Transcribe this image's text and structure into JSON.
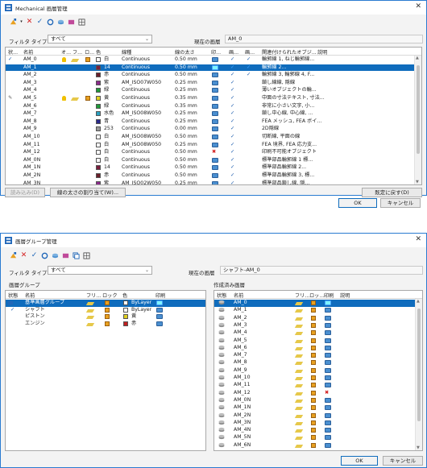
{
  "dialog1": {
    "title": "Mechanical 画層管理",
    "filter_label": "フィルタ タイプ:",
    "filter_value": "すべて",
    "current_layer_label": "現在の画層",
    "current_layer_value": "AM_0",
    "columns": [
      "状...",
      "名前",
      "オ...",
      "フ...",
      "ロ...",
      "色",
      "線種",
      "線の太さ",
      "印...",
      "画...",
      "画...",
      "関連付けられたオブジ...",
      "説明"
    ],
    "rows": [
      {
        "status": "check",
        "name": "AM_0",
        "on": "bulb",
        "freeze": "sun",
        "lock": "lock",
        "color_swatch": "#ffffff",
        "color": "白",
        "linetype": "Continuous",
        "lineweight": "0.50 mm",
        "plot": "print",
        "c1": "check",
        "c2": "check",
        "assoc": "輪郭線 1, ねじ輪郭線..."
      },
      {
        "status": "",
        "name": "AM_1",
        "on": "",
        "freeze": "",
        "lock": "",
        "color_swatch": "#7a1f3d",
        "color": "14",
        "linetype": "Continuous",
        "lineweight": "0.50 mm",
        "plot": "print",
        "c1": "check",
        "c2": "check",
        "assoc": "輪郭線 2...",
        "selected": true
      },
      {
        "status": "",
        "name": "AM_2",
        "on": "",
        "freeze": "",
        "lock": "",
        "color_swatch": "#6a1f2a",
        "color": "赤",
        "linetype": "Continuous",
        "lineweight": "0.50 mm",
        "plot": "print",
        "c1": "check",
        "c2": "check",
        "assoc": "輪郭線 3, 輪郭線 4, F..."
      },
      {
        "status": "",
        "name": "AM_3",
        "on": "",
        "freeze": "",
        "lock": "",
        "color_swatch": "#8a2a8a",
        "color": "紫",
        "linetype": "AM_ISO07W050",
        "lineweight": "0.25 mm",
        "plot": "print",
        "c1": "check",
        "c2": "",
        "assoc": "鎖し線線, 隠線"
      },
      {
        "status": "",
        "name": "AM_4",
        "on": "",
        "freeze": "",
        "lock": "",
        "color_swatch": "#1f9a3a",
        "color": "緑",
        "linetype": "Continuous",
        "lineweight": "0.25 mm",
        "plot": "print",
        "c1": "check",
        "c2": "",
        "assoc": "薄いオブジェクトの輪..."
      },
      {
        "status": "pen",
        "name": "AM_5",
        "on": "bulb",
        "freeze": "sun",
        "lock": "lock",
        "color_swatch": "#e0d020",
        "color": "黄",
        "linetype": "Continuous",
        "lineweight": "0.35 mm",
        "plot": "print",
        "c1": "check",
        "c2": "",
        "assoc": "中面の寸法テキスト, 寸法..."
      },
      {
        "status": "",
        "name": "AM_6",
        "on": "",
        "freeze": "",
        "lock": "",
        "color_swatch": "#1f9a3a",
        "color": "緑",
        "linetype": "Continuous",
        "lineweight": "0.35 mm",
        "plot": "print",
        "c1": "check",
        "c2": "",
        "assoc": "非常に小さい文字, 小..."
      },
      {
        "status": "",
        "name": "AM_7",
        "on": "",
        "freeze": "",
        "lock": "",
        "color_swatch": "#2aa0c0",
        "color": "水色",
        "linetype": "AM_ISO08W050",
        "lineweight": "0.25 mm",
        "plot": "print",
        "c1": "check",
        "c2": "",
        "assoc": "鎖し中心線, 中心線, ..."
      },
      {
        "status": "",
        "name": "AM_8",
        "on": "",
        "freeze": "",
        "lock": "",
        "color_swatch": "#2a2a8a",
        "color": "青",
        "linetype": "Continuous",
        "lineweight": "0.25 mm",
        "plot": "print",
        "c1": "check",
        "c2": "",
        "assoc": "FEA メッシュ, FEA ボイ..."
      },
      {
        "status": "",
        "name": "AM_9",
        "on": "",
        "freeze": "",
        "lock": "",
        "color_swatch": "#9a9a9a",
        "color": "253",
        "linetype": "Continuous",
        "lineweight": "0.00 mm",
        "plot": "print",
        "c1": "check",
        "c2": "",
        "assoc": "2D隠線"
      },
      {
        "status": "",
        "name": "AM_10",
        "on": "",
        "freeze": "",
        "lock": "",
        "color_swatch": "#ffffff",
        "color": "白",
        "linetype": "AM_ISO08W050",
        "lineweight": "0.50 mm",
        "plot": "print",
        "c1": "check",
        "c2": "",
        "assoc": "切断線, 平面の線"
      },
      {
        "status": "",
        "name": "AM_11",
        "on": "",
        "freeze": "",
        "lock": "",
        "color_swatch": "#ffffff",
        "color": "白",
        "linetype": "AM_ISO08W050",
        "lineweight": "0.25 mm",
        "plot": "print",
        "c1": "check",
        "c2": "",
        "assoc": "FEA 境界, FEA 応力支..."
      },
      {
        "status": "",
        "name": "AM_12",
        "on": "",
        "freeze": "",
        "lock": "",
        "color_swatch": "#ffffff",
        "color": "白",
        "linetype": "Continuous",
        "lineweight": "0.50 mm",
        "plot": "noprint",
        "c1": "check",
        "c2": "",
        "assoc": "印刷不可能オブジェクト"
      },
      {
        "status": "",
        "name": "AM_0N",
        "on": "",
        "freeze": "",
        "lock": "",
        "color_swatch": "#ffffff",
        "color": "白",
        "linetype": "Continuous",
        "lineweight": "0.50 mm",
        "plot": "print",
        "c1": "check",
        "c2": "",
        "assoc": "標準部品輪郭線 1 標..."
      },
      {
        "status": "",
        "name": "AM_1N",
        "on": "",
        "freeze": "",
        "lock": "",
        "color_swatch": "#7a1f3d",
        "color": "14",
        "linetype": "Continuous",
        "lineweight": "0.50 mm",
        "plot": "print",
        "c1": "check",
        "c2": "",
        "assoc": "標準部品輪郭線 2..."
      },
      {
        "status": "",
        "name": "AM_2N",
        "on": "",
        "freeze": "",
        "lock": "",
        "color_swatch": "#6a1f2a",
        "color": "赤",
        "linetype": "Continuous",
        "lineweight": "0.50 mm",
        "plot": "print",
        "c1": "check",
        "c2": "",
        "assoc": "標準部品輪郭線 3, 標..."
      },
      {
        "status": "",
        "name": "AM_3N",
        "on": "",
        "freeze": "",
        "lock": "",
        "color_swatch": "#8a2a8a",
        "color": "紫",
        "linetype": "AM_ISO02W050",
        "lineweight": "0.25 mm",
        "plot": "print",
        "c1": "check",
        "c2": "",
        "assoc": "標準部品鎖し線, 隠..."
      }
    ],
    "btn_load": "読み込み(D)",
    "btn_assign": "線の太さの割り当て(W)...",
    "btn_reset": "既定に戻す(D)",
    "btn_ok": "OK",
    "btn_cancel": "キャンセル"
  },
  "dialog2": {
    "title": "画層グループ管理",
    "filter_label": "フィルタ タイプ:",
    "filter_value": "すべて",
    "current_layer_label": "現在の画層",
    "current_layer_value": "シャフト-AM_0",
    "groups_label": "画層グループ",
    "created_label": "作成済み画層",
    "left_columns": [
      "状態",
      "名前",
      "フリ...",
      "ロック",
      "色",
      "",
      "印刷"
    ],
    "groups": [
      {
        "status": "",
        "name": "基準画層グループ",
        "color_swatch": "#ffffff",
        "color": "ByLayer",
        "selected": true
      },
      {
        "status": "check",
        "name": "シャフト",
        "color_swatch": "#ffffff",
        "color": "ByLayer"
      },
      {
        "status": "",
        "name": "ピストン",
        "color_swatch": "#e0d020",
        "color": "黄"
      },
      {
        "status": "",
        "name": "エンジン",
        "color_swatch": "#c02020",
        "color": "赤"
      }
    ],
    "right_columns": [
      "状態",
      "名前",
      "フリ...",
      "ロッ...",
      "印刷",
      "説明"
    ],
    "layers": [
      {
        "name": "AM_0",
        "plot": "print",
        "selected": true
      },
      {
        "name": "AM_1",
        "plot": "print"
      },
      {
        "name": "AM_2",
        "plot": "print"
      },
      {
        "name": "AM_3",
        "plot": "print"
      },
      {
        "name": "AM_4",
        "plot": "print"
      },
      {
        "name": "AM_5",
        "plot": "print"
      },
      {
        "name": "AM_6",
        "plot": "print"
      },
      {
        "name": "AM_7",
        "plot": "print"
      },
      {
        "name": "AM_8",
        "plot": "print"
      },
      {
        "name": "AM_9",
        "plot": "print"
      },
      {
        "name": "AM_10",
        "plot": "print"
      },
      {
        "name": "AM_11",
        "plot": "print"
      },
      {
        "name": "AM_12",
        "plot": "noprint"
      },
      {
        "name": "AM_0N",
        "plot": "print"
      },
      {
        "name": "AM_1N",
        "plot": "print"
      },
      {
        "name": "AM_2N",
        "plot": "print"
      },
      {
        "name": "AM_3N",
        "plot": "print"
      },
      {
        "name": "AM_4N",
        "plot": "print"
      },
      {
        "name": "AM_5N",
        "plot": "print"
      },
      {
        "name": "AM_6N",
        "plot": "print"
      }
    ],
    "btn_ok": "OK",
    "btn_cancel": "キャンセル"
  }
}
